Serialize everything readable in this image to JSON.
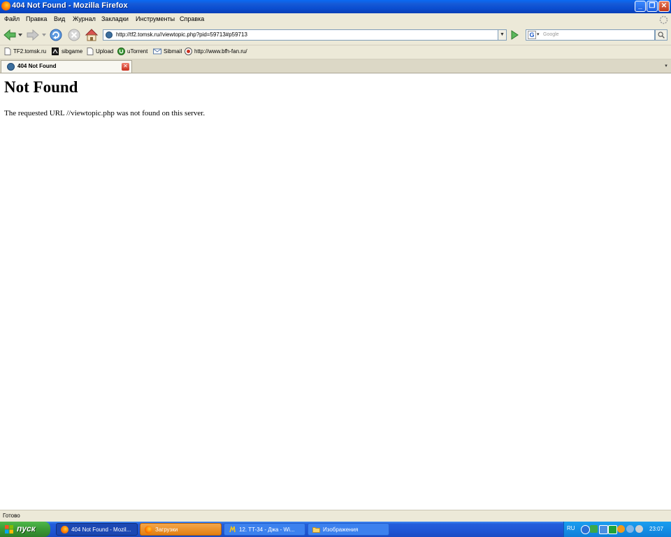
{
  "window": {
    "title": "404 Not Found - Mozilla Firefox",
    "minimize_glyph": "_",
    "restore_glyph": "❐",
    "close_glyph": "✕"
  },
  "menu": {
    "items": [
      "Файл",
      "Правка",
      "Вид",
      "Журнал",
      "Закладки",
      "Инструменты",
      "Справка"
    ]
  },
  "nav": {
    "url": "http://tf2.tomsk.ru//viewtopic.php?pid=59713#p59713",
    "search_placeholder": "Google",
    "search_engine_letter": "G"
  },
  "bookmarks": {
    "items": [
      {
        "label": "TF2.tomsk.ru",
        "icon": "page-icon"
      },
      {
        "label": "sibgame",
        "icon": "sibgame-icon"
      },
      {
        "label": "Upload",
        "icon": "page-icon"
      },
      {
        "label": "uTorrent",
        "icon": "utorrent-icon"
      },
      {
        "label": "Sibmail",
        "icon": "mail-icon"
      },
      {
        "label": "http://www.bfh-fan.ru/",
        "icon": "target-icon"
      }
    ]
  },
  "tabs": {
    "active_label": "404 Not Found",
    "close_glyph": "✕",
    "list_glyph": "▾"
  },
  "content": {
    "heading": "Not Found",
    "message": "The requested URL //viewtopic.php was not found on this server."
  },
  "status": {
    "text": "Готово"
  },
  "taskbar": {
    "start_label": "пуск",
    "items": [
      {
        "label": "404 Not Found - Mozil...",
        "icon": "firefox-icon",
        "state": "active"
      },
      {
        "label": "Загрузки",
        "icon": "firefox-icon",
        "state": "highlighted"
      },
      {
        "label": "12. TT-34 - Джа - Wi...",
        "icon": "winamp-icon",
        "state": "normal"
      },
      {
        "label": "Изображения",
        "icon": "folder-icon",
        "state": "normal"
      }
    ],
    "tray": {
      "language": "RU",
      "clock": "23:07"
    }
  },
  "colors": {
    "titlebar": "#0b4fd1",
    "chrome": "#ece9d8",
    "taskbar": "#245edb",
    "start_green": "#3a9a35",
    "highlighted_task": "#e98a1c"
  }
}
